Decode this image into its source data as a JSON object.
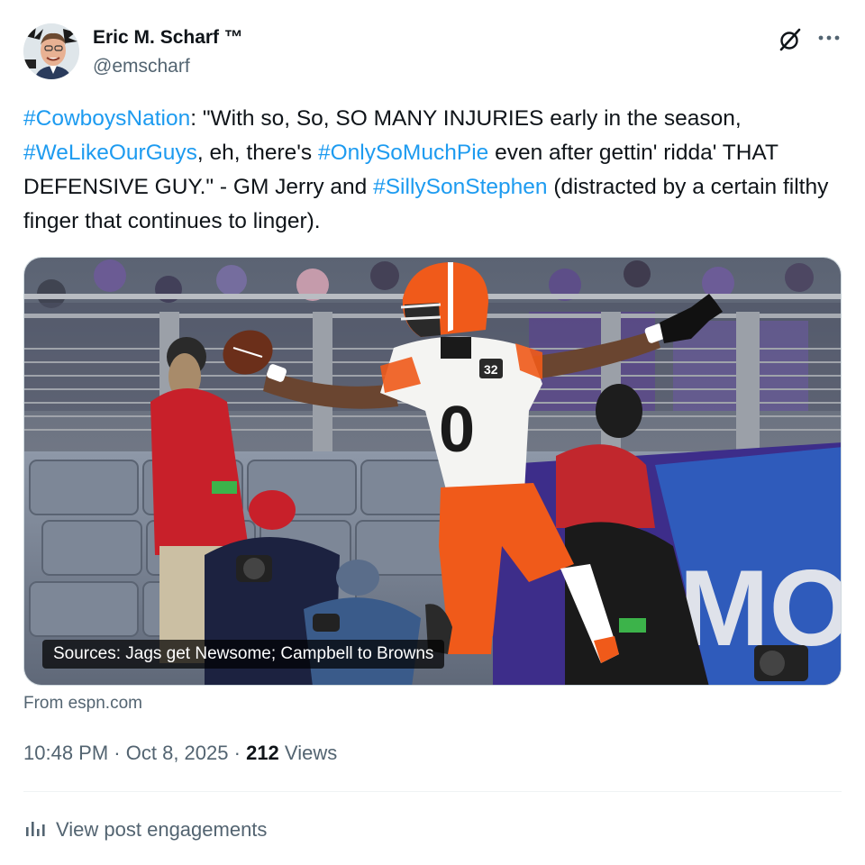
{
  "author": {
    "display_name": "Eric M. Scharf ™",
    "handle": "@emscharf"
  },
  "header_icons": {
    "grok": "grok-icon",
    "more": "more-options-icon"
  },
  "tweet": {
    "segments": [
      {
        "text": "#CowboysNation",
        "hashtag": true
      },
      {
        "text": ": \"With so, So, SO MANY INJURIES early in the season, ",
        "hashtag": false
      },
      {
        "text": "#WeLikeOurGuys",
        "hashtag": true
      },
      {
        "text": ", eh, there's ",
        "hashtag": false
      },
      {
        "text": "#OnlySoMuchPie",
        "hashtag": true
      },
      {
        "text": " even after gettin' ridda' THAT DEFENSIVE GUY.\" - GM Jerry and ",
        "hashtag": false
      },
      {
        "text": "#SillySonStephen",
        "hashtag": true
      },
      {
        "text": " (distracted by a certain filthy finger that continues to linger).",
        "hashtag": false
      }
    ]
  },
  "card": {
    "caption": "Sources: Jags get Newsome; Campbell to Browns",
    "source": "From espn.com",
    "image_subject": "football player in white jersey number 0 and orange pants celebrating",
    "jersey_number": "0",
    "patch_number": "32",
    "banner_text": "TIMO"
  },
  "meta": {
    "time": "10:48 PM",
    "separator": "·",
    "date": "Oct 8, 2025",
    "views_count": "212",
    "views_label": "Views"
  },
  "engagements": {
    "icon": "analytics-icon",
    "label": "View post engagements"
  },
  "colors": {
    "link": "#1d9bf0",
    "text": "#0f1419",
    "secondary": "#536471",
    "orange": "#f05a1a",
    "red_jacket": "#c8202a"
  }
}
